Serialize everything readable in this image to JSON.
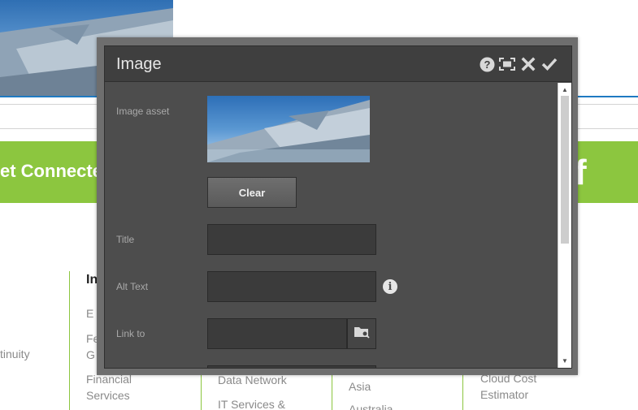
{
  "background": {
    "banner_text": "et Connecte",
    "facebook_glyph": "f",
    "column_heading": "In",
    "col1": {
      "item1": "tinuity"
    },
    "col2": {
      "item1": "E",
      "item2a": "Fe",
      "item2b": "G",
      "item3a": "Financial",
      "item3b": "Services"
    },
    "col3": {
      "item1": "Data Network",
      "item2": "IT Services &"
    },
    "col4": {
      "item1": "Asia",
      "item2": "Australia"
    },
    "col5": {
      "item1a": "Cloud Cost",
      "item1b": "Estimator"
    }
  },
  "dialog": {
    "title": "Image",
    "header_icons": [
      "help-icon",
      "fullscreen-icon",
      "close-icon",
      "check-icon"
    ],
    "fields": {
      "image_asset_label": "Image asset",
      "clear_label": "Clear",
      "title_label": "Title",
      "title_value": "",
      "alt_text_label": "Alt Text",
      "alt_text_value": "",
      "link_to_label": "Link to",
      "link_to_value": ""
    },
    "info_glyph": "i"
  },
  "colors": {
    "dialog_bg": "#4d4d4d",
    "dialog_header": "#3f3f3f",
    "banner_green": "#8cc63f",
    "accent_blue": "#1f7ac2"
  }
}
